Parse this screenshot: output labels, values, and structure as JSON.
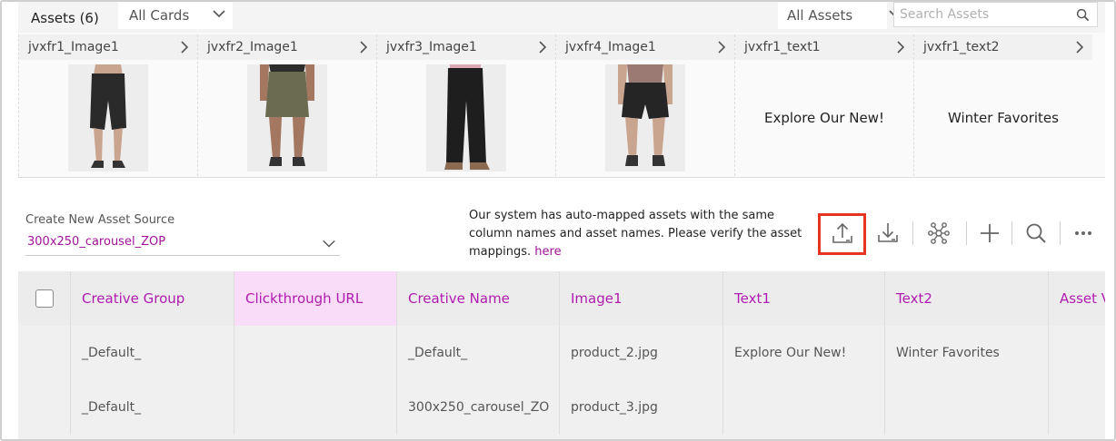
{
  "assets": {
    "title": "Assets (6)",
    "filter_cards": "All Cards",
    "filter_assets": "All Assets",
    "search_placeholder": "Search Assets",
    "cards": [
      {
        "label": "jvxfr1_Image1",
        "kind": "image",
        "garment": "black-bike-shorts"
      },
      {
        "label": "jvxfr2_Image1",
        "kind": "image",
        "garment": "olive-skort"
      },
      {
        "label": "jvxfr3_Image1",
        "kind": "image",
        "garment": "black-wide-leg-pants"
      },
      {
        "label": "jvxfr4_Image1",
        "kind": "image",
        "garment": "black-shorts"
      },
      {
        "label": "jvxfr1_text1",
        "kind": "text",
        "text": "Explore Our New!"
      },
      {
        "label": "jvxfr1_text2",
        "kind": "text",
        "text": "Winter Favorites"
      }
    ]
  },
  "source": {
    "label": "Create New Asset Source",
    "value": "300x250_carousel_ZOP"
  },
  "notice": {
    "text": "Our system has auto-mapped assets with the same column names and asset names. Please verify the asset mappings.",
    "link": "here"
  },
  "toolbar": {
    "icons": [
      "upload-icon",
      "download-icon",
      "network-icon",
      "plus-icon",
      "search-icon",
      "more-icon"
    ],
    "highlight_color": "#e53520"
  },
  "table": {
    "columns": [
      "Creative Group",
      "Clickthrough URL",
      "Creative Name",
      "Image1",
      "Text1",
      "Text2",
      "Asset V"
    ],
    "rows": [
      [
        "_Default_",
        "",
        "_Default_",
        "product_2.jpg",
        "Explore Our New!",
        "Winter Favorites",
        ""
      ],
      [
        "_Default_",
        "",
        "300x250_carousel_ZO",
        "product_3.jpg",
        "",
        "",
        ""
      ]
    ]
  },
  "colors": {
    "accent": "#b01cb0",
    "highlight_column_bg": "#f9dcf7"
  }
}
